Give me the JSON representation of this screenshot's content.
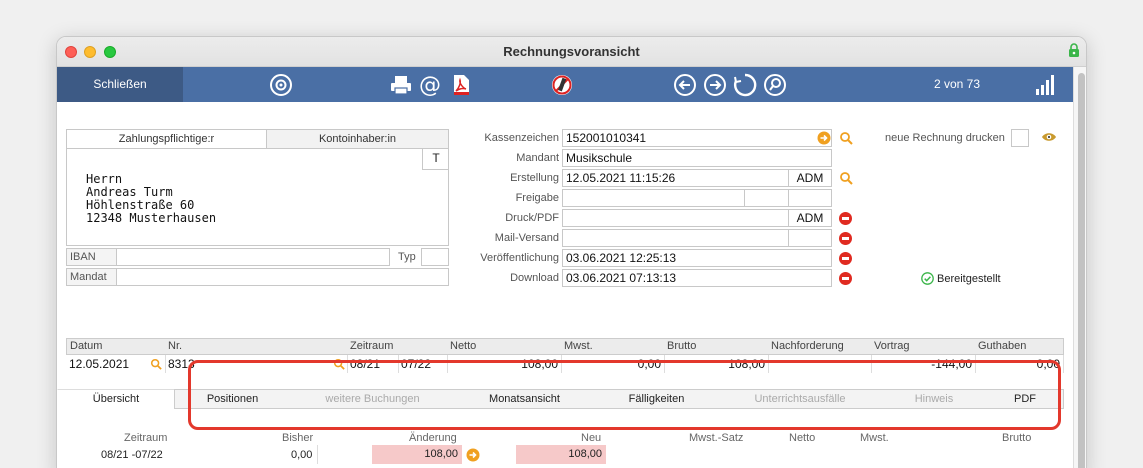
{
  "window": {
    "title": "Rechnungsvoransicht"
  },
  "toolbar": {
    "close_label": "Schließen",
    "record_count": "2 von 73",
    "icons": [
      "gear-icon",
      "printer-icon",
      "at-icon",
      "pdf-icon",
      "no-pencil-icon",
      "arrow-left-icon",
      "arrow-right-icon",
      "refresh-icon",
      "search-icon",
      "signal-icon"
    ]
  },
  "payer": {
    "tabs": [
      "Zahlungspflichtige:r",
      "Kontoinhaber:in"
    ],
    "t_button": "T",
    "address_lines": [
      "Herrn",
      "Andreas Turm",
      "Höhlenstraße 60",
      "12348 Musterhausen"
    ],
    "iban_label": "IBAN",
    "iban_value": "",
    "typ_label": "Typ",
    "typ_value": "",
    "mandat_label": "Mandat",
    "mandat_value": ""
  },
  "invoice": {
    "kassenzeichen_label": "Kassenzeichen",
    "kassenzeichen_value": "152001010341",
    "mandant_label": "Mandant",
    "mandant_value": "Musikschule",
    "erstellung_label": "Erstellung",
    "erstellung_value": "12.05.2021 11:15:26",
    "erstellung_user": "ADM",
    "freigabe_label": "Freigabe",
    "freigabe_value": "",
    "druck_label": "Druck/PDF",
    "druck_value": "",
    "druck_user": "ADM",
    "mail_label": "Mail-Versand",
    "mail_value": "",
    "veroeff_label": "Veröffentlichung",
    "veroeff_value": "03.06.2021 12:25:13",
    "download_label": "Download",
    "download_value": "03.06.2021 07:13:13",
    "reprint_label": "neue Rechnung drucken",
    "status_label": "Bereitgestellt"
  },
  "summary": {
    "headers": [
      "Datum",
      "Nr.",
      "Zeitraum",
      "Netto",
      "Mwst.",
      "Brutto",
      "Nachforderung",
      "Vortrag",
      "Guthaben"
    ],
    "row": {
      "datum": "12.05.2021",
      "nr": "8313",
      "zeitraum_from": "08/21",
      "zeitraum_to": "07/22",
      "netto": "108,00",
      "mwst": "0,00",
      "brutto": "108,00",
      "nachforderung": "",
      "vortrag": "-144,00",
      "guthaben": "0,00"
    }
  },
  "tabs": [
    {
      "label": "Übersicht",
      "state": "active"
    },
    {
      "label": "Positionen",
      "state": "enabled"
    },
    {
      "label": "weitere Buchungen",
      "state": "disabled"
    },
    {
      "label": "Monatsansicht",
      "state": "enabled"
    },
    {
      "label": "Fälligkeiten",
      "state": "enabled"
    },
    {
      "label": "Unterrichtsausfälle",
      "state": "disabled"
    },
    {
      "label": "Hinweis",
      "state": "disabled"
    },
    {
      "label": "PDF",
      "state": "enabled"
    }
  ],
  "overview": {
    "headers": [
      "Zeitraum",
      "Bisher",
      "Änderung",
      "Neu",
      "Mwst.-Satz",
      "Netto",
      "Mwst.",
      "Brutto"
    ],
    "row": {
      "zeitraum": "08/21 -07/22",
      "bisher": "0,00",
      "aenderung": "108,00",
      "neu": "108,00"
    }
  },
  "colors": {
    "toolbar": "#4a6fa5",
    "close_button": "#3d5a85",
    "highlight": "#e3382c",
    "pink": "#f6c9c9",
    "accent_orange": "#f0a020"
  }
}
